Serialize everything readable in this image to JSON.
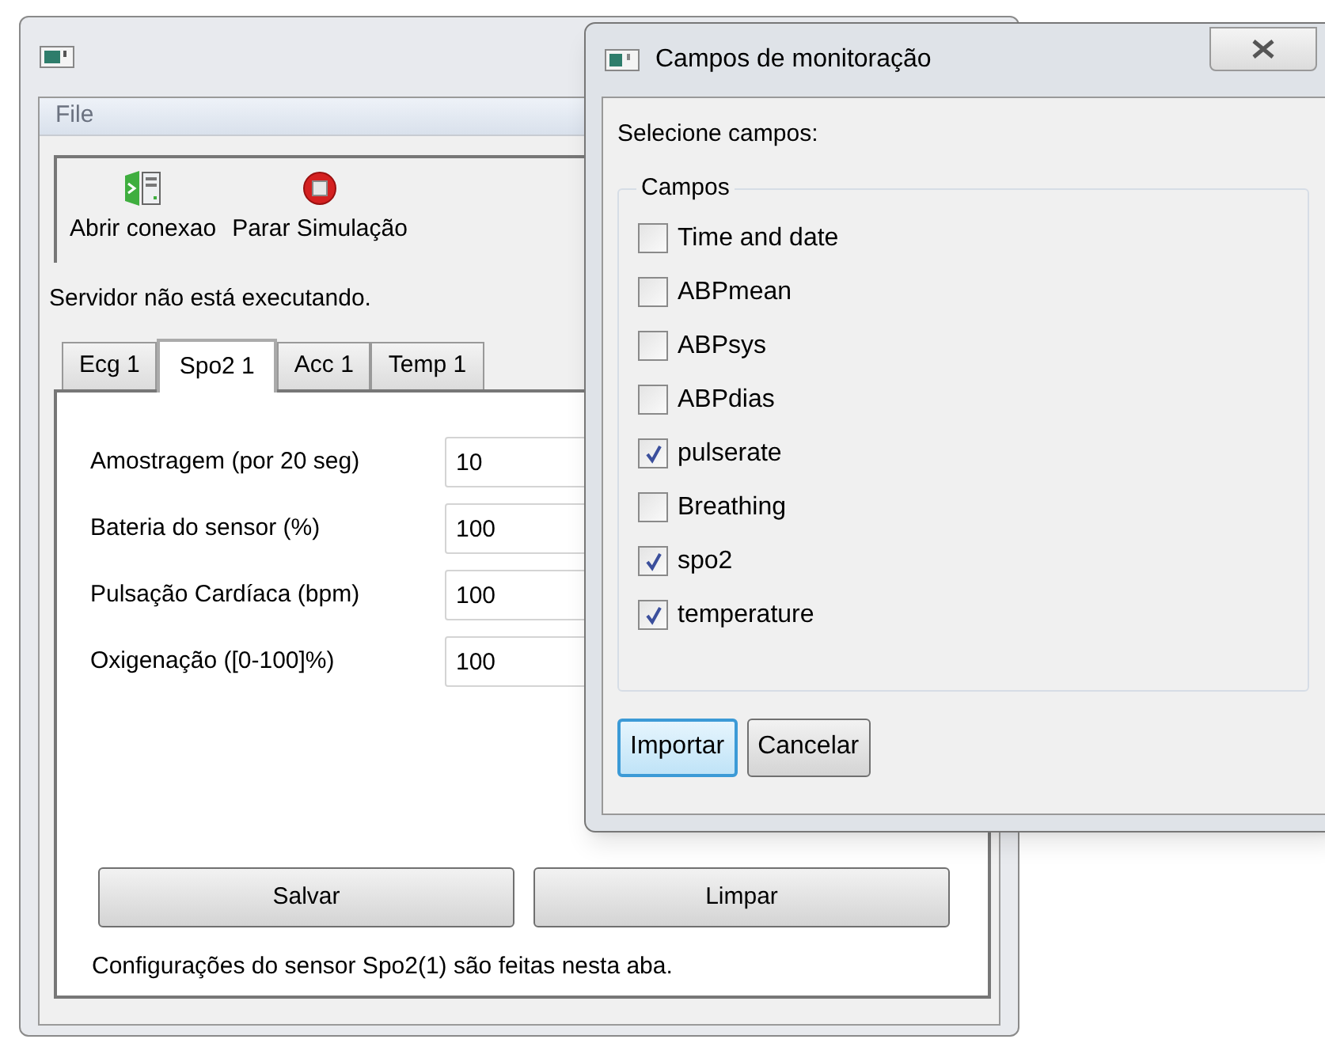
{
  "main_window": {
    "menu": [
      "File"
    ],
    "toolbar": [
      {
        "kind": "connect",
        "label": "Abrir conexao"
      },
      {
        "kind": "stop",
        "label": "Parar Simulação"
      }
    ],
    "status": "Servidor não está executando.",
    "tabs": [
      {
        "label": "Ecg 1",
        "selected": false
      },
      {
        "label": "Spo2 1",
        "selected": true
      },
      {
        "label": "Acc 1",
        "selected": false
      },
      {
        "label": "Temp 1",
        "selected": false
      }
    ],
    "fields": [
      {
        "label": "Amostragem (por 20 seg)",
        "value": "10"
      },
      {
        "label": "Bateria do sensor (%)",
        "value": "100"
      },
      {
        "label": "Pulsação Cardíaca (bpm)",
        "value": "100"
      },
      {
        "label": "Oxigenação ([0-100]%)",
        "value": "100"
      }
    ],
    "buttons": [
      "Salvar",
      "Limpar"
    ],
    "footer": "Configurações do sensor Spo2(1) são feitas nesta aba."
  },
  "dialog": {
    "title": "Campos de monitoração",
    "prompt": "Selecione campos:",
    "group": "Campos",
    "checkboxes": [
      {
        "label": "Time and date",
        "checked": false
      },
      {
        "label": "ABPmean",
        "checked": false
      },
      {
        "label": "ABPsys",
        "checked": false
      },
      {
        "label": "ABPdias",
        "checked": false
      },
      {
        "label": "pulserate",
        "checked": true
      },
      {
        "label": "Breathing",
        "checked": false
      },
      {
        "label": "spo2",
        "checked": true
      },
      {
        "label": "temperature",
        "checked": true
      }
    ],
    "buttons": [
      {
        "label": "Importar",
        "default": true
      },
      {
        "label": "Cancelar",
        "default": false
      }
    ]
  }
}
